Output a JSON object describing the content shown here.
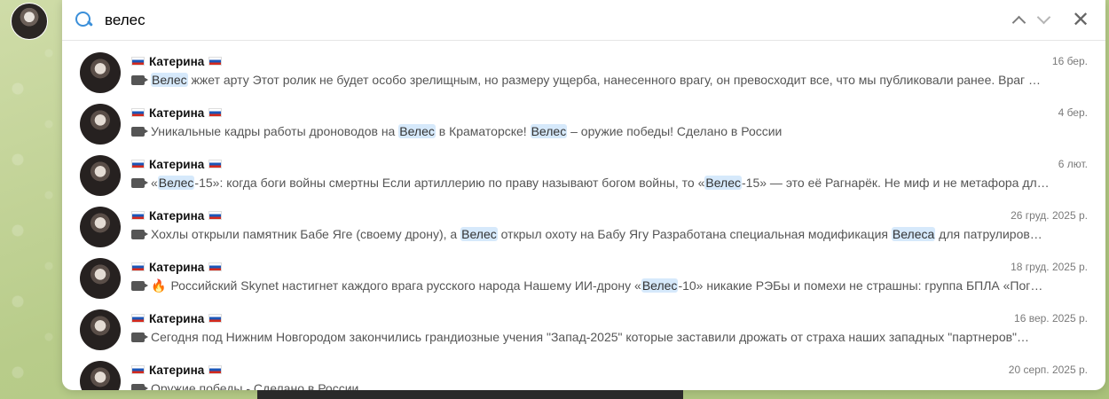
{
  "search": {
    "query": "велес"
  },
  "results": [
    {
      "name": "Катерина",
      "date": "16 бер.",
      "parts": [
        {
          "t": "Велес",
          "hl": true
        },
        {
          "t": " жжет арту Этот ролик не будет особо зрелищным, но размеру ущерба, нанесенного врагу, он превосходит все, что мы публиковали ранее. Враг …",
          "hl": false
        }
      ]
    },
    {
      "name": "Катерина",
      "date": "4 бер.",
      "parts": [
        {
          "t": "Уникальные кадры работы дроноводов на ",
          "hl": false
        },
        {
          "t": "Велес",
          "hl": true
        },
        {
          "t": " в Краматорске! ",
          "hl": false
        },
        {
          "t": "Велес",
          "hl": true
        },
        {
          "t": " – оружие победы! Сделано в России",
          "hl": false
        }
      ]
    },
    {
      "name": "Катерина",
      "date": "6 лют.",
      "parts": [
        {
          "t": "«",
          "hl": false
        },
        {
          "t": "Велес",
          "hl": true
        },
        {
          "t": "-15»: когда боги войны смертны Если артиллерию по праву называют богом войны, то «",
          "hl": false
        },
        {
          "t": "Велес",
          "hl": true
        },
        {
          "t": "-15» — это её Рагнарёк. Не миф и не метафора дл…",
          "hl": false
        }
      ]
    },
    {
      "name": "Катерина",
      "date": "26 груд. 2025 р.",
      "parts": [
        {
          "t": "Хохлы открыли памятник Бабе Яге (своему дрону), а ",
          "hl": false
        },
        {
          "t": "Велес",
          "hl": true
        },
        {
          "t": " открыл охоту на Бабу Ягу Разработана специальная модификация ",
          "hl": false
        },
        {
          "t": "Велеса",
          "hl": true
        },
        {
          "t": " для патрулиров…",
          "hl": false
        }
      ]
    },
    {
      "name": "Катерина",
      "date": "18 груд. 2025 р.",
      "fire": true,
      "parts": [
        {
          "t": "Российский Skynet настигнет каждого врага русского народа Нашему ИИ-дрону «",
          "hl": false
        },
        {
          "t": "Велес",
          "hl": true
        },
        {
          "t": "-10» никакие РЭБы и помехи не страшны: группа БПЛА «Пог…",
          "hl": false
        }
      ]
    },
    {
      "name": "Катерина",
      "date": "16 вер. 2025 р.",
      "parts": [
        {
          "t": "Сегодня под Нижним Новгородом закончились грандиозные учения \"Запад-2025\" которые заставили дрожать от страха наших западных \"партнеров\"…",
          "hl": false
        }
      ]
    },
    {
      "name": "Катерина",
      "date": "20 серп. 2025 р.",
      "parts": [
        {
          "t": "Оружие победы - Сделано в России",
          "hl": false
        }
      ]
    }
  ]
}
